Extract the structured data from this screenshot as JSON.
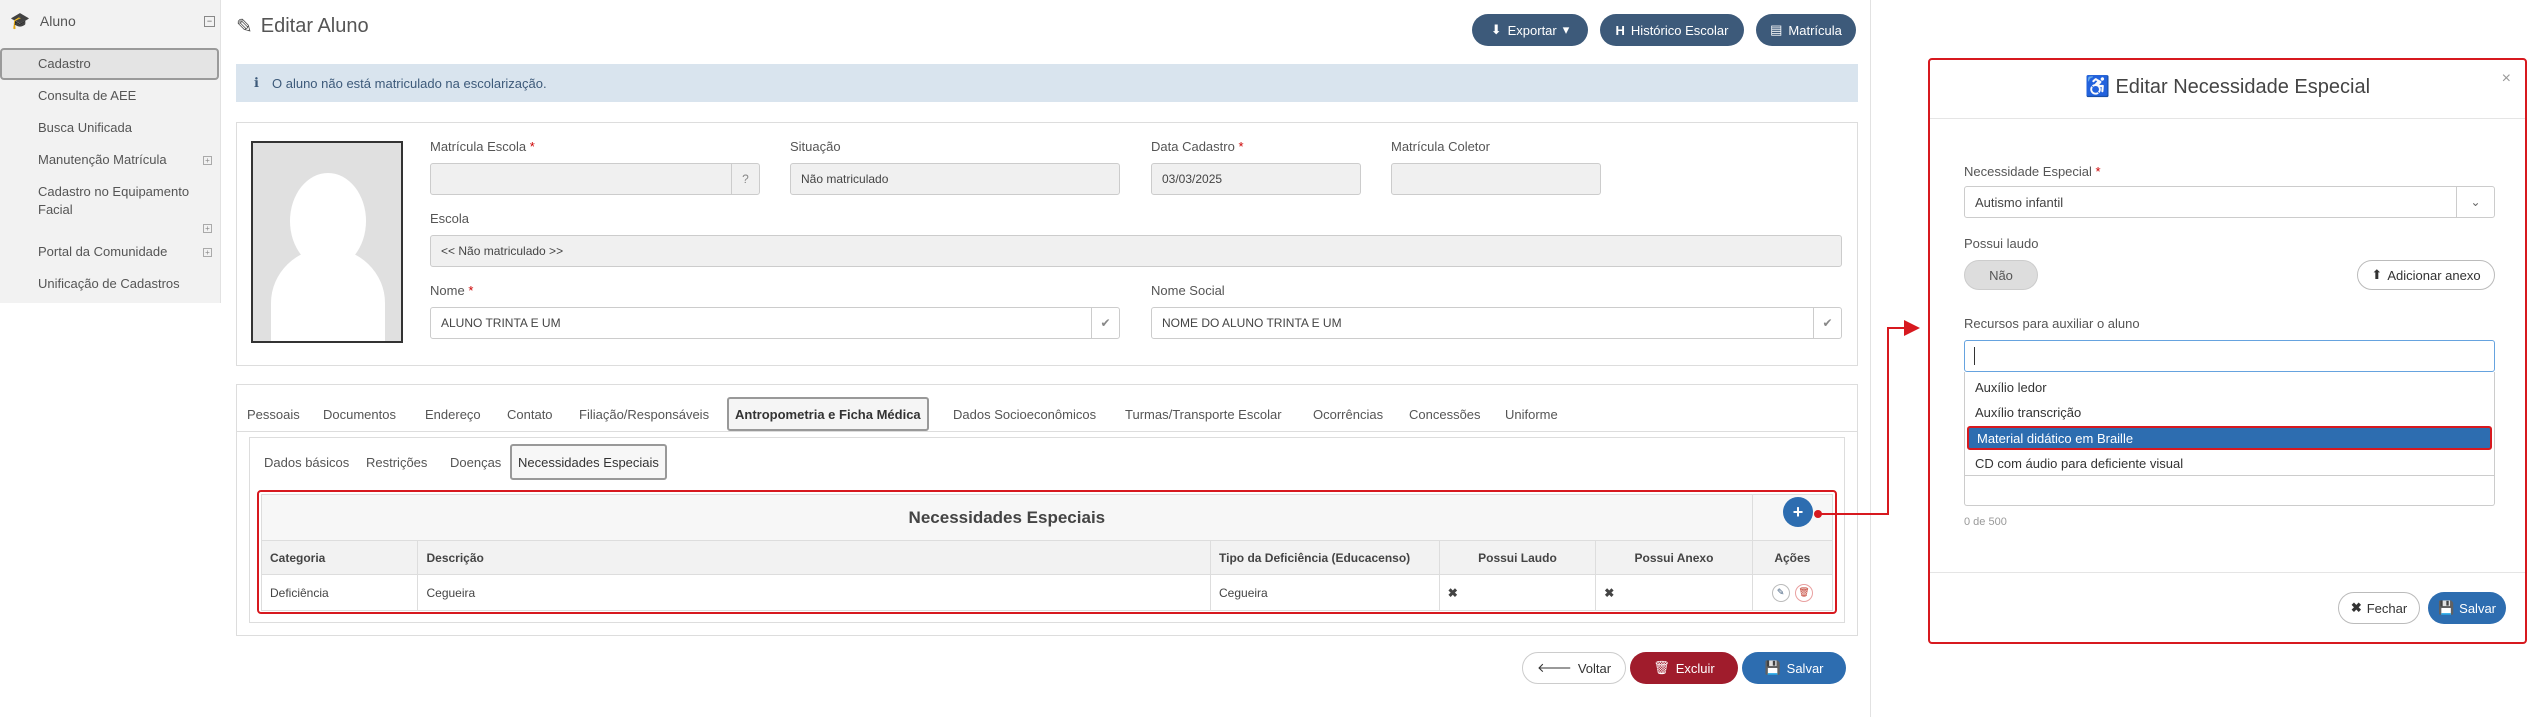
{
  "sidebar": {
    "header": "Aluno",
    "items": [
      {
        "label": "Cadastro"
      },
      {
        "label": "Consulta de AEE"
      },
      {
        "label": "Busca Unificada"
      },
      {
        "label": "Manutenção Matrícula"
      },
      {
        "label": "Cadastro no Equipamento Facial"
      },
      {
        "label": "Portal da Comunidade"
      },
      {
        "label": "Unificação de Cadastros"
      }
    ]
  },
  "page": {
    "title": "Editar Aluno",
    "buttons": {
      "export": "Exportar",
      "history": "Histórico Escolar",
      "enrollment": "Matrícula"
    },
    "alert": "O aluno não está matriculado na escolarização."
  },
  "form": {
    "matricula_escola": {
      "label": "Matrícula Escola",
      "value": ""
    },
    "situacao": {
      "label": "Situação",
      "value": "Não matriculado"
    },
    "data_cadastro": {
      "label": "Data Cadastro",
      "value": "03/03/2025"
    },
    "matricula_coletor": {
      "label": "Matrícula Coletor",
      "value": ""
    },
    "escola": {
      "label": "Escola",
      "value": "<< Não matriculado >>"
    },
    "nome": {
      "label": "Nome",
      "value": "ALUNO TRINTA E UM"
    },
    "nome_social": {
      "label": "Nome Social",
      "value": "NOME DO ALUNO TRINTA E UM"
    }
  },
  "tabs": [
    "Pessoais",
    "Documentos",
    "Endereço",
    "Contato",
    "Filiação/Responsáveis",
    "Antropometria e Ficha Médica",
    "Dados Socioeconômicos",
    "Turmas/Transporte Escolar",
    "Ocorrências",
    "Concessões",
    "Uniforme"
  ],
  "subtabs": [
    "Dados básicos",
    "Restrições",
    "Doenças",
    "Necessidades Especiais"
  ],
  "table": {
    "title": "Necessidades Especiais",
    "columns": [
      "Categoria",
      "Descrição",
      "Tipo da Deficiência (Educacenso)",
      "Possui Laudo",
      "Possui Anexo",
      "Ações"
    ],
    "rows": [
      {
        "categoria": "Deficiência",
        "descricao": "Cegueira",
        "tipo": "Cegueira",
        "laudo": "✖",
        "anexo": "✖"
      }
    ]
  },
  "footer": {
    "back": "Voltar",
    "delete": "Excluir",
    "save": "Salvar"
  },
  "modal": {
    "title": "Editar Necessidade Especial",
    "necessidade_label": "Necessidade Especial",
    "necessidade_value": "Autismo infantil",
    "laudo_label": "Possui laudo",
    "laudo_toggle": "Não",
    "add_attachment": "Adicionar anexo",
    "recursos_label": "Recursos para auxiliar o aluno",
    "recursos_value": "",
    "options": [
      "Auxílio ledor",
      "Auxílio transcrição",
      "Material didático em Braille",
      "CD com áudio para deficiente visual"
    ],
    "selected_option_index": 2,
    "char_counter": "0 de 500",
    "close": "Fechar",
    "save": "Salvar"
  },
  "colors": {
    "accent": "#2d6db0",
    "dark_button": "#3d5a7a",
    "danger": "#a01c2c",
    "highlight": "#d7191f"
  }
}
